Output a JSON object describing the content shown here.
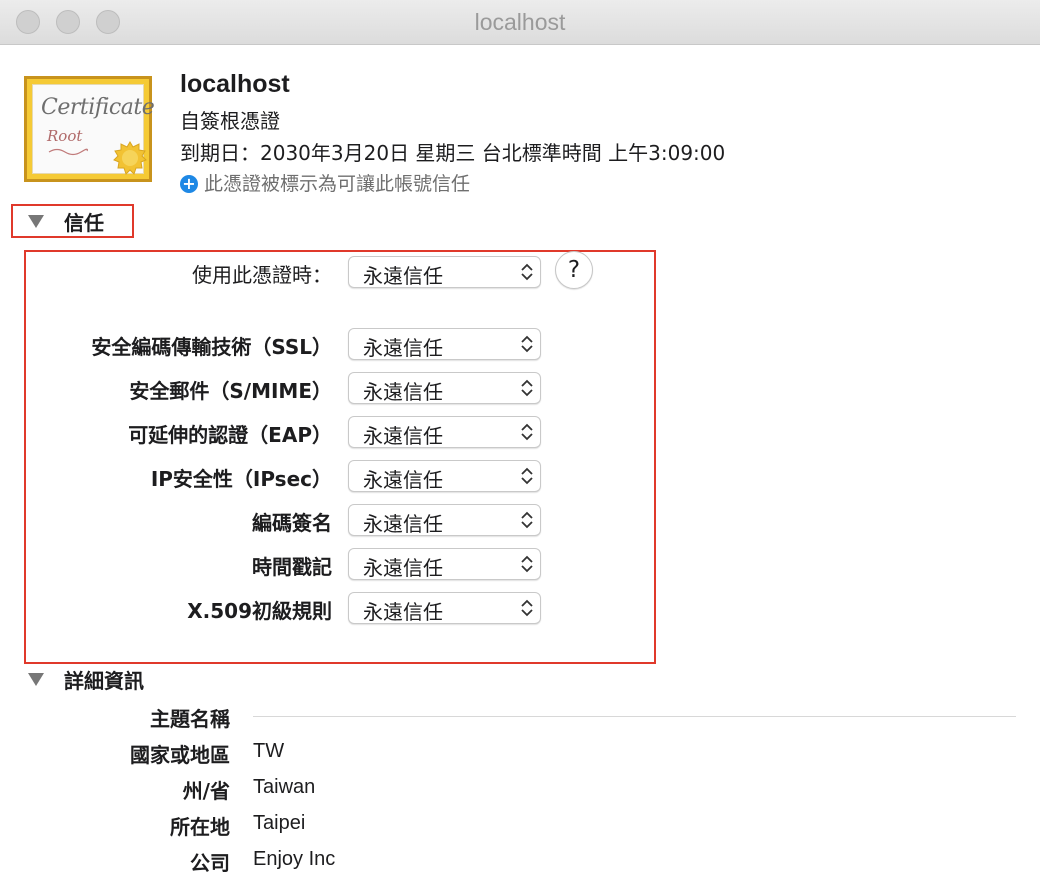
{
  "window": {
    "title": "localhost"
  },
  "certificate": {
    "icon_word": "Certificate",
    "icon_sub": "Root",
    "name": "localhost",
    "type": "自簽根憑證",
    "expiry": "到期日：2030年3月20日 星期三 台北標準時間 上午3:09:00",
    "trust_note": "此憑證被標示為可讓此帳號信任",
    "trust_note_icon": "plus-circle-icon",
    "accent_color": "#1e88e5"
  },
  "trust": {
    "heading": "信任",
    "expanded": true,
    "when_using_label": "使用此憑證時：",
    "when_using_value": "永遠信任",
    "help_label": "?",
    "rows": [
      {
        "label": "安全編碼傳輸技術（SSL）",
        "value": "永遠信任"
      },
      {
        "label": "安全郵件（S/MIME）",
        "value": "永遠信任"
      },
      {
        "label": "可延伸的認證（EAP）",
        "value": "永遠信任"
      },
      {
        "label": "IP安全性（IPsec）",
        "value": "永遠信任"
      },
      {
        "label": "編碼簽名",
        "value": "永遠信任"
      },
      {
        "label": "時間戳記",
        "value": "永遠信任"
      },
      {
        "label": "X.509初級規則",
        "value": "永遠信任"
      }
    ]
  },
  "details": {
    "heading": "詳細資訊",
    "expanded": true,
    "subject_heading": "主題名稱",
    "fields": [
      {
        "label": "國家或地區",
        "value": "TW"
      },
      {
        "label": "州/省",
        "value": "Taiwan"
      },
      {
        "label": "所在地",
        "value": "Taipei"
      },
      {
        "label": "公司",
        "value": "Enjoy Inc"
      }
    ]
  },
  "colors": {
    "highlight_box": "#e0392b",
    "seal": "#f2c233"
  }
}
